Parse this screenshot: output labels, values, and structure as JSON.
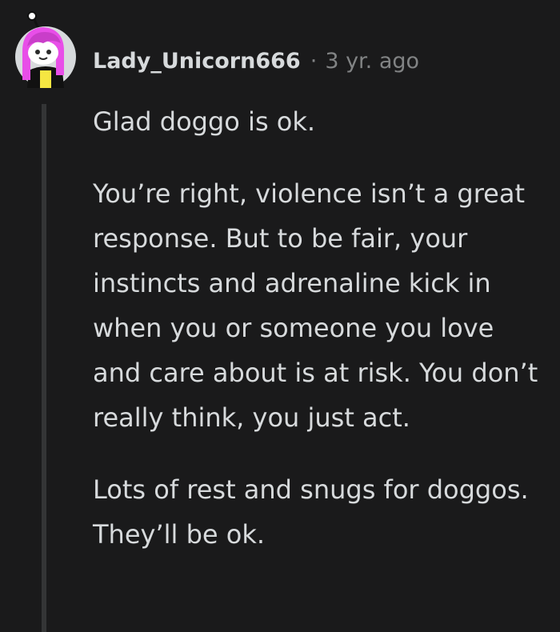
{
  "comment": {
    "author": "Lady_Unicorn666",
    "separator": "·",
    "timestamp": "3 yr. ago",
    "avatar_icon": "snoo-avatar-icon",
    "paragraphs": [
      "Glad doggo is ok.",
      "You’re right, violence isn’t a great response. But to be fair, your instincts and adrenaline kick in when you or someone you love and care about is at risk. You don’t really think, you just act.",
      "Lots of rest and snugs for doggos. They’ll be ok."
    ]
  },
  "colors": {
    "background": "#1a1a1b",
    "text": "#d7dadc",
    "muted": "#818384",
    "thread_line": "#343536",
    "avatar_circle": "#d7dadc",
    "avatar_hair": "#e84ee8",
    "avatar_shirt": "#f5e642"
  }
}
